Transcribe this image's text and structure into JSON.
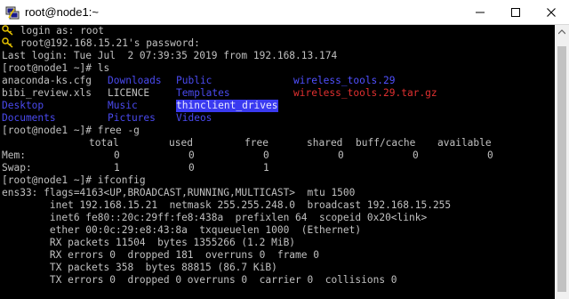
{
  "window": {
    "title": "root@node1:~",
    "controls": {
      "minimize": "minimize-icon",
      "maximize": "maximize-icon",
      "close": "close-icon"
    }
  },
  "colors": {
    "background": "#000000",
    "text": "#c0c0c0",
    "dir": "#4a4af0",
    "archive": "#e03030",
    "highlight": "#3a3af0"
  },
  "terminal": {
    "login_as": "login as: root",
    "password": "root@192.168.15.21's password:",
    "last_login": "Last login: Tue Jul  2 07:39:35 2019 from 192.168.13.174",
    "prompt_ls": "[root@node1 ~]# ls",
    "ls": [
      [
        "anaconda-ks.cfg",
        "Downloads",
        "Public",
        "wireless_tools.29"
      ],
      [
        "bibi_review.xls",
        "LICENCE",
        "Templates",
        "wireless_tools.29.tar.gz"
      ],
      [
        "Desktop",
        "Music",
        "thinclient_drives",
        ""
      ],
      [
        "Documents",
        "Pictures",
        "Videos",
        ""
      ]
    ],
    "prompt_free": "[root@node1 ~]# free -g",
    "free_header": [
      "total",
      "used",
      "free",
      "shared",
      "buff/cache",
      "available"
    ],
    "free_rows": [
      {
        "label": "Mem:",
        "values": [
          "0",
          "0",
          "0",
          "0",
          "0",
          "0"
        ]
      },
      {
        "label": "Swap:",
        "values": [
          "1",
          "0",
          "1",
          "",
          "",
          ""
        ]
      }
    ],
    "prompt_ifconfig": "[root@node1 ~]# ifconfig",
    "ifconfig": [
      "ens33: flags=4163<UP,BROADCAST,RUNNING,MULTICAST>  mtu 1500",
      "        inet 192.168.15.21  netmask 255.255.248.0  broadcast 192.168.15.255",
      "        inet6 fe80::20c:29ff:fe8:438a  prefixlen 64  scopeid 0x20<link>",
      "        ether 00:0c:29:e8:43:8a  txqueuelen 1000  (Ethernet)",
      "        RX packets 11504  bytes 1355266 (1.2 MiB)",
      "        RX errors 0  dropped 181  overruns 0  frame 0",
      "        TX packets 358  bytes 88815 (86.7 KiB)",
      "        TX errors 0  dropped 0 overruns 0  carrier 0  collisions 0"
    ]
  }
}
